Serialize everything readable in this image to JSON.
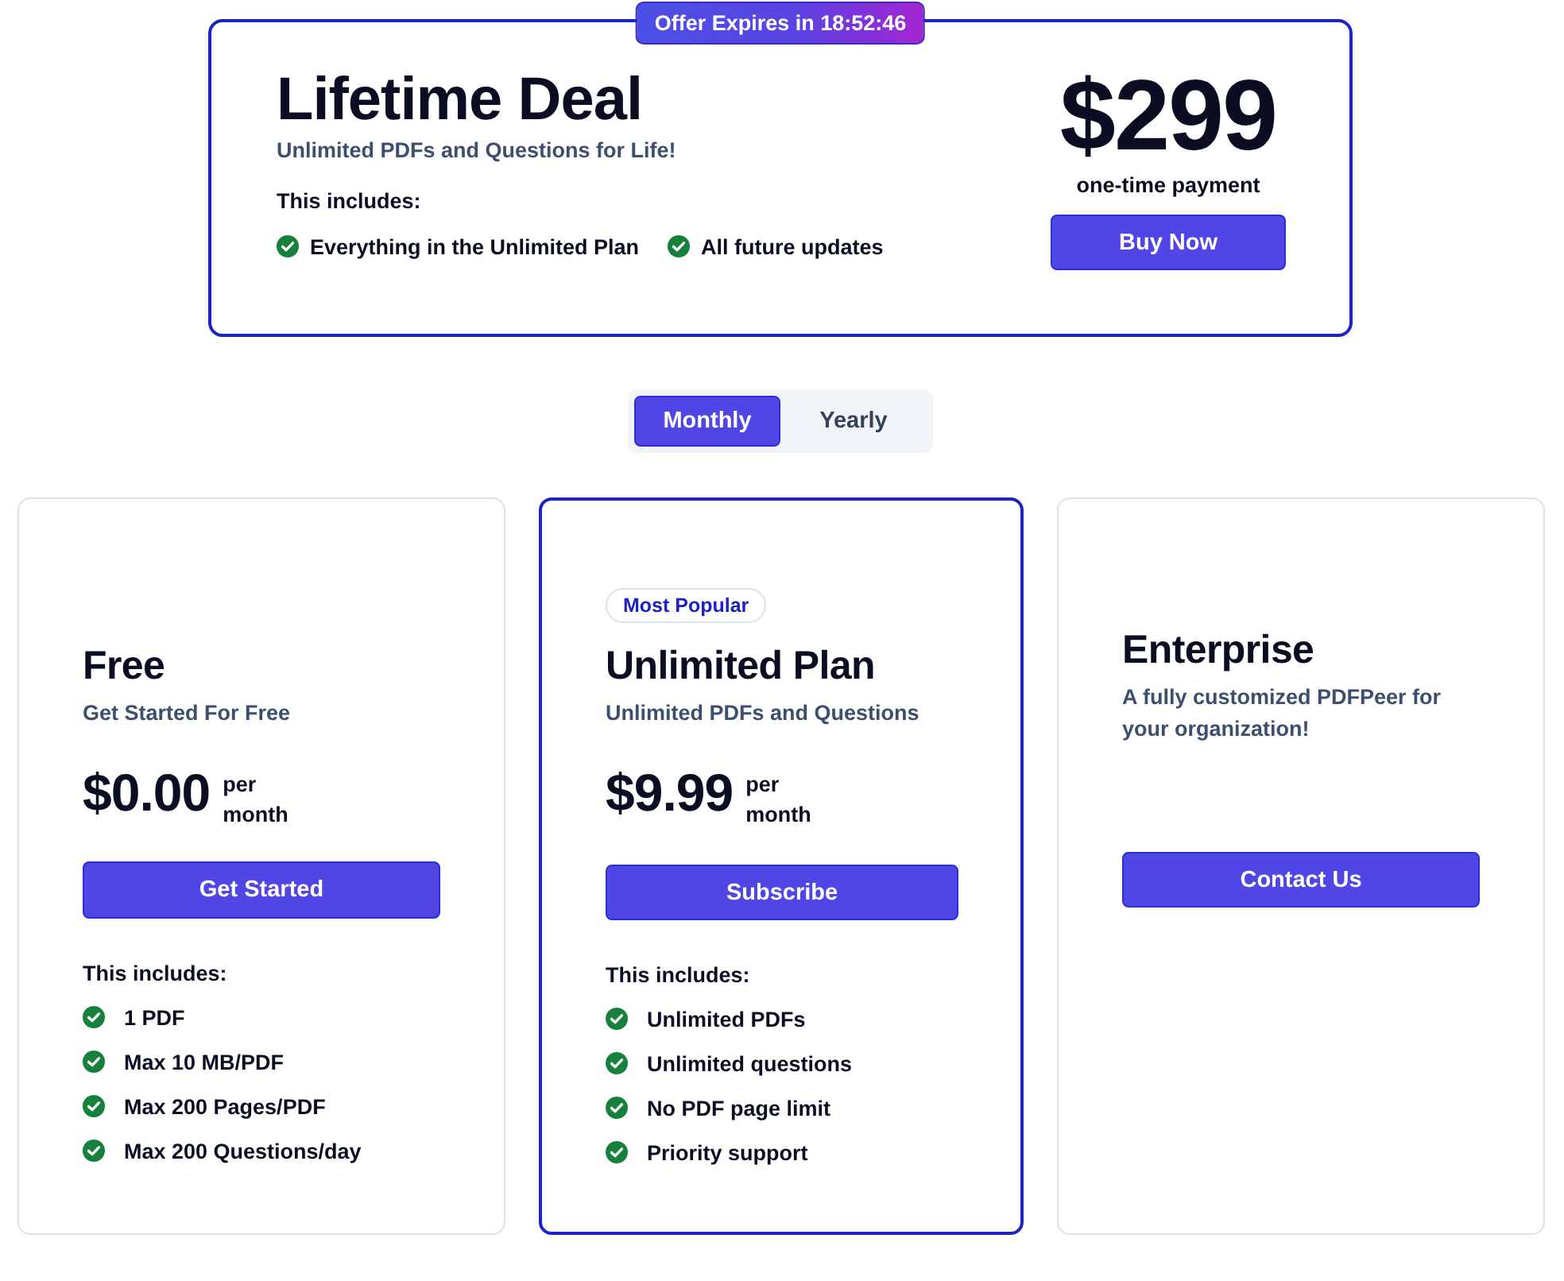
{
  "offer": {
    "badge": "Offer Expires in 18:52:46",
    "title": "Lifetime Deal",
    "subtitle": "Unlimited PDFs and Questions for Life!",
    "includes_label": "This includes:",
    "features": [
      "Everything in the Unlimited Plan",
      "All future updates"
    ],
    "price": "$299",
    "price_note": "one-time payment",
    "button": "Buy Now"
  },
  "billing_period": [
    {
      "label": "Monthly",
      "selected": true
    },
    {
      "label": "Yearly",
      "selected": false
    }
  ],
  "plans": [
    {
      "name": "Free",
      "subtitle": "Get Started For Free",
      "price": "$0.00",
      "period": "per month",
      "button": "Get Started",
      "highlighted": false,
      "includes_label": "This includes:",
      "features": [
        "1 PDF",
        "Max 10 MB/PDF",
        "Max 200 Pages/PDF",
        "Max 200 Questions/day"
      ]
    },
    {
      "badge": "Most Popular",
      "name": "Unlimited Plan",
      "subtitle": "Unlimited PDFs and Questions",
      "price": "$9.99",
      "period": "per month",
      "button": "Subscribe",
      "highlighted": true,
      "includes_label": "This includes:",
      "features": [
        "Unlimited PDFs",
        "Unlimited questions",
        "No PDF page limit",
        "Priority support"
      ]
    },
    {
      "name": "Enterprise",
      "subtitle": "A fully customized PDFPeer for your organization!",
      "button": "Contact Us",
      "highlighted": false
    }
  ]
}
